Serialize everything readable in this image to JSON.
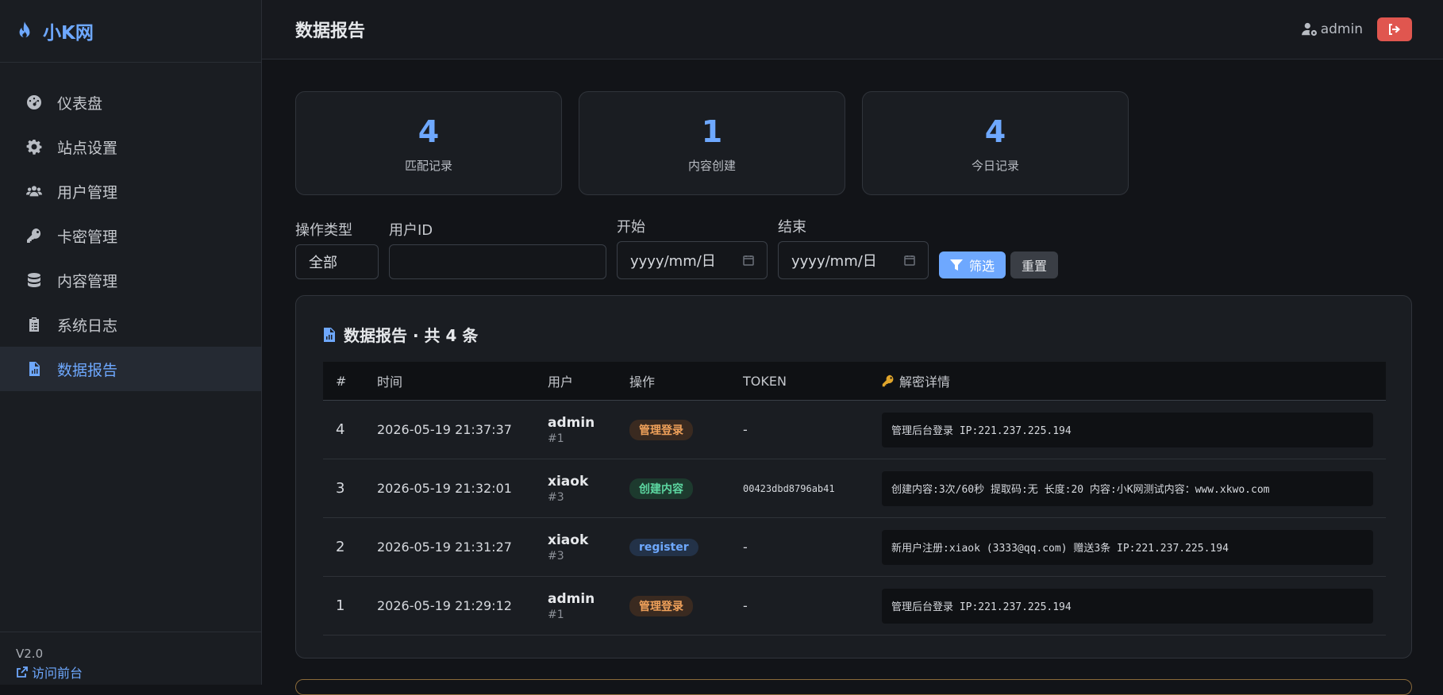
{
  "brand": {
    "name": "小K网"
  },
  "sidebar": {
    "items": [
      {
        "label": "仪表盘",
        "icon": "dashboard-icon"
      },
      {
        "label": "站点设置",
        "icon": "gear-icon"
      },
      {
        "label": "用户管理",
        "icon": "users-icon"
      },
      {
        "label": "卡密管理",
        "icon": "key-icon"
      },
      {
        "label": "内容管理",
        "icon": "database-icon"
      },
      {
        "label": "系统日志",
        "icon": "clipboard-icon"
      },
      {
        "label": "数据报告",
        "icon": "file-chart-icon",
        "active": true
      }
    ],
    "version": "V2.0",
    "front_link": "访问前台"
  },
  "topbar": {
    "title": "数据报告",
    "user": "admin"
  },
  "stats": [
    {
      "value": "4",
      "label": "匹配记录"
    },
    {
      "value": "1",
      "label": "内容创建"
    },
    {
      "value": "4",
      "label": "今日记录"
    }
  ],
  "filters": {
    "type_label": "操作类型",
    "type_value": "全部",
    "uid_label": "用户ID",
    "uid_value": "",
    "start_label": "开始",
    "start_value": "yyyy/mm/日",
    "end_label": "结束",
    "end_value": "yyyy/mm/日",
    "filter_button": "筛选",
    "reset_button": "重置"
  },
  "panel": {
    "title": "数据报告 · 共 4 条",
    "columns": [
      "#",
      "时间",
      "用户",
      "操作",
      "TOKEN",
      "解密详情"
    ],
    "rows": [
      {
        "id": "4",
        "time": "2026-05-19 21:37:37",
        "user": "admin",
        "uid": "#1",
        "action": "管理登录",
        "badge": "orange",
        "token": "-",
        "detail": "管理后台登录 IP:221.237.225.194"
      },
      {
        "id": "3",
        "time": "2026-05-19 21:32:01",
        "user": "xiaok",
        "uid": "#3",
        "action": "创建内容",
        "badge": "green",
        "token": "00423dbd8796ab41",
        "detail": "创建内容:3次/60秒 提取码:无 长度:20 内容:小K网测试内容：www.xkwo.com"
      },
      {
        "id": "2",
        "time": "2026-05-19 21:31:27",
        "user": "xiaok",
        "uid": "#3",
        "action": "register",
        "badge": "blue",
        "token": "-",
        "detail": "新用户注册:xiaok (3333@qq.com) 赠送3条 IP:221.237.225.194"
      },
      {
        "id": "1",
        "time": "2026-05-19 21:29:12",
        "user": "admin",
        "uid": "#1",
        "action": "管理登录",
        "badge": "orange",
        "token": "-",
        "detail": "管理后台登录 IP:221.237.225.194"
      }
    ]
  },
  "colors": {
    "accent": "#6ea8fe",
    "danger": "#e0564f",
    "badge_orange": "#f0a15a",
    "badge_green": "#5cd6a0"
  }
}
